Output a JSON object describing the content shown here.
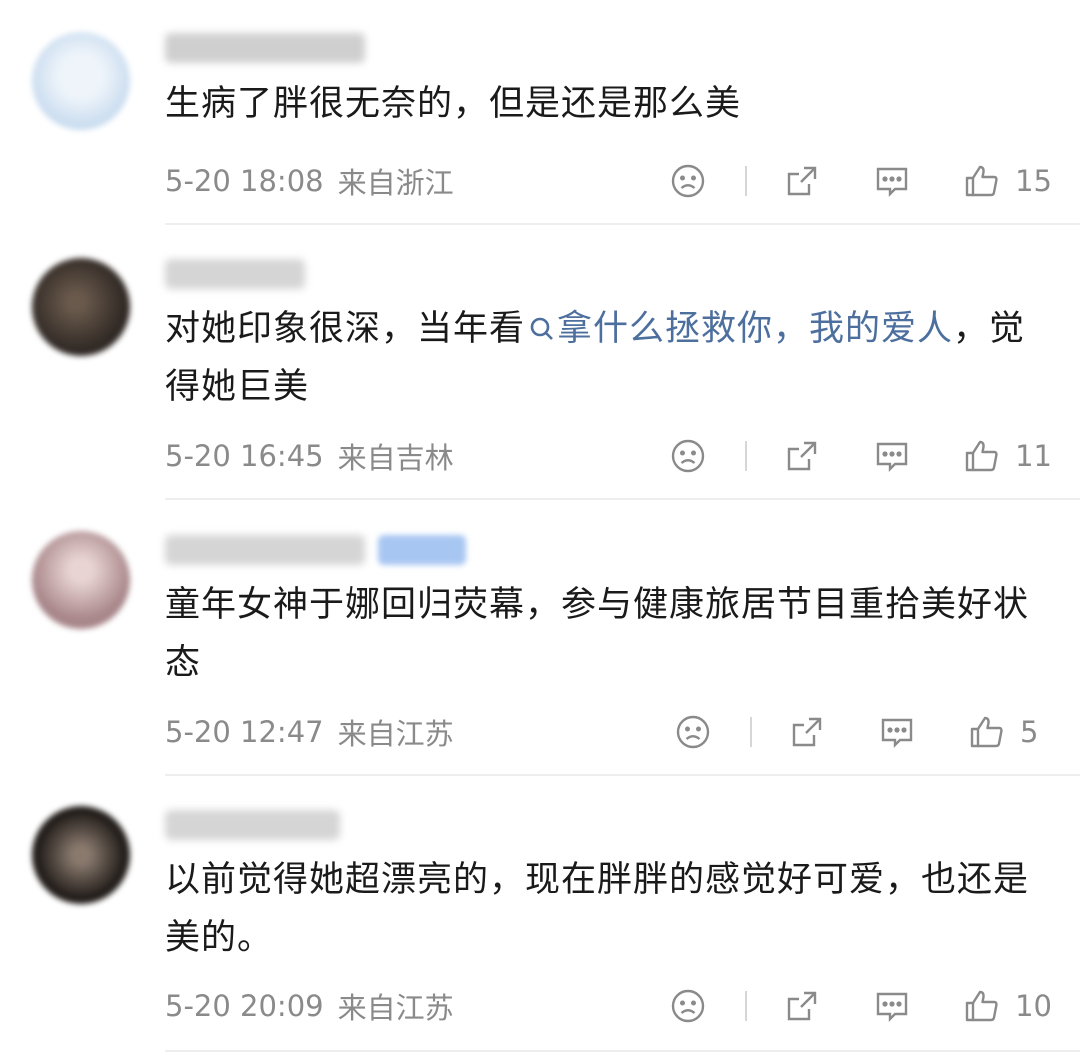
{
  "comments": [
    {
      "text_before": "生病了胖很无奈的，但是还是那么美",
      "link_text": "",
      "text_after": "",
      "time": "5-20 18:08",
      "location": "来自浙江",
      "likes": "15",
      "avatar_color": "#c9dcef",
      "has_tag": false
    },
    {
      "text_before": "对她印象很深，当年看",
      "link_text": "拿什么拯救你，我的爱人",
      "text_after": "，觉得她巨美",
      "time": "5-20 16:45",
      "location": "来自吉林",
      "likes": "11",
      "avatar_color": "#3a322c",
      "has_tag": false
    },
    {
      "text_before": "童年女神于娜回归荧幕，参与健康旅居节目重拾美好状态",
      "link_text": "",
      "text_after": "",
      "time": "5-20 12:47",
      "location": "来自江苏",
      "likes": "5",
      "avatar_color": "#b89a9a",
      "has_tag": true
    },
    {
      "text_before": "以前觉得她超漂亮的，现在胖胖的感觉好可爱，也还是美的。",
      "link_text": "",
      "text_after": "",
      "time": "5-20 20:09",
      "location": "来自江苏",
      "likes": "10",
      "avatar_color": "#2b2622",
      "has_tag": false
    }
  ],
  "icons": {
    "dislike": "sad-face-icon",
    "share": "share-icon",
    "reply": "comment-icon",
    "like": "thumbs-up-icon"
  },
  "colors": {
    "link": "#4d6f9e",
    "meta": "#8a8a8a",
    "tag": "#a8c6f2"
  }
}
